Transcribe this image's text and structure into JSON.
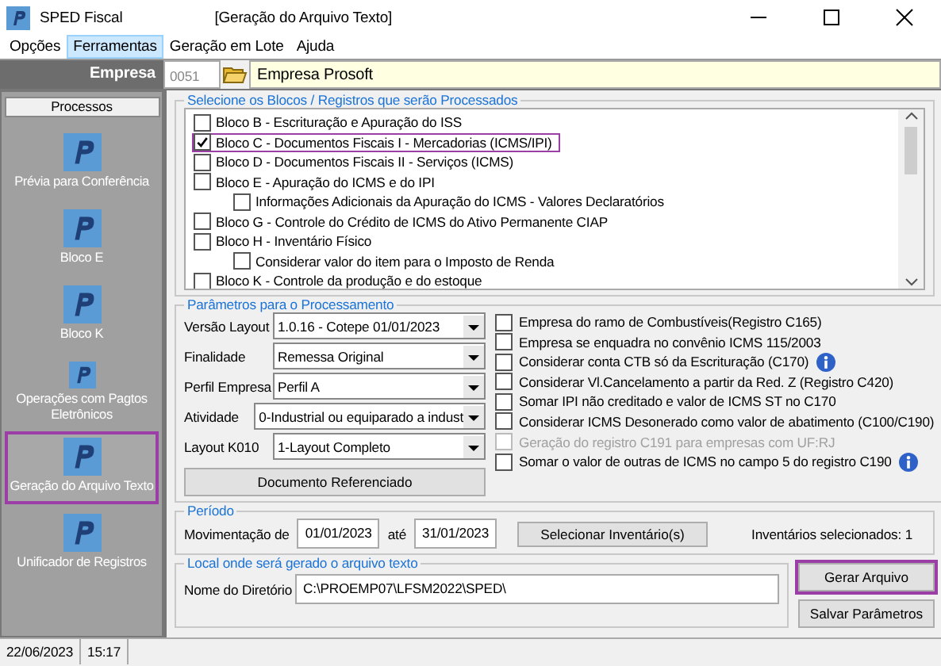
{
  "window": {
    "app_title": "SPED Fiscal",
    "document_title": "[Geração do Arquivo Texto]"
  },
  "menu": [
    {
      "label": "Opções",
      "selected": false
    },
    {
      "label": "Ferramentas",
      "selected": true
    },
    {
      "label": "Geração em Lote",
      "selected": false
    },
    {
      "label": "Ajuda",
      "selected": false
    }
  ],
  "company": {
    "label": "Empresa",
    "code": "0051",
    "name": "Empresa Prosoft"
  },
  "sidebar": {
    "header": "Processos",
    "items": [
      {
        "label": "Prévia para Conferência",
        "selected": false
      },
      {
        "label": "Bloco E",
        "selected": false
      },
      {
        "label": "Bloco K",
        "selected": false
      },
      {
        "label": "Operações com Pagtos Eletrônicos",
        "selected": false
      },
      {
        "label": "Geração do Arquivo Texto",
        "selected": true
      },
      {
        "label": "Unificador de Registros",
        "selected": false
      }
    ]
  },
  "blocks": {
    "title": "Selecione os Blocos / Registros que serão Processados",
    "items": [
      {
        "label": "Bloco B - Escrituração e Apuração do ISS",
        "checked": false,
        "highlighted": false
      },
      {
        "label": "Bloco C - Documentos Fiscais I - Mercadorias (ICMS/IPI)",
        "checked": true,
        "highlighted": true
      },
      {
        "label": "Bloco D - Documentos Fiscais II - Serviços (ICMS)",
        "checked": false,
        "highlighted": false
      },
      {
        "label": "Bloco E - Apuração do ICMS e do IPI",
        "checked": false,
        "highlighted": false,
        "children": [
          {
            "label": "Informações Adicionais da Apuração do ICMS - Valores Declaratórios",
            "checked": false,
            "highlighted": false
          }
        ]
      },
      {
        "label": "Bloco G - Controle do Crédito de ICMS do Ativo Permanente CIAP",
        "checked": false,
        "highlighted": false
      },
      {
        "label": "Bloco H - Inventário Físico",
        "checked": false,
        "highlighted": false,
        "children": [
          {
            "label": "Considerar valor do item para o Imposto de Renda",
            "checked": false,
            "highlighted": false
          }
        ]
      },
      {
        "label": "Bloco K - Controle da produção e do estoque",
        "checked": false,
        "highlighted": false
      }
    ]
  },
  "parameters": {
    "title": "Parâmetros para o Processamento",
    "fields": [
      {
        "label": "Versão Layout",
        "value": "1.0.16 - Cotepe 01/01/2023"
      },
      {
        "label": "Finalidade",
        "value": "Remessa Original"
      },
      {
        "label": "Perfil Empresa",
        "value": "Perfil A"
      },
      {
        "label": "Atividade",
        "value": "0-Industrial ou equiparado a indust"
      },
      {
        "label": "Layout K010",
        "value": "1-Layout Completo"
      }
    ],
    "button": "Documento Referenciado",
    "options": [
      {
        "label": "Empresa do ramo de Combustíveis(Registro C165)",
        "checked": false,
        "disabled": false
      },
      {
        "label": "Empresa se enquadra no convênio ICMS 115/2003",
        "checked": false,
        "disabled": false
      },
      {
        "label": "Considerar conta CTB só da Escrituração (C170)",
        "checked": false,
        "disabled": false,
        "info": true
      },
      {
        "label": "Considerar Vl.Cancelamento a partir da Red. Z (Registro C420)",
        "checked": false,
        "disabled": false
      },
      {
        "label": "Somar IPI não creditado e valor de ICMS ST no C170",
        "checked": false,
        "disabled": false
      },
      {
        "label": "Considerar ICMS Desonerado como valor de abatimento (C100/C190)",
        "checked": false,
        "disabled": false
      },
      {
        "label": "Geração do registro C191 para empresas com UF:RJ",
        "checked": false,
        "disabled": true
      },
      {
        "label": "Somar o valor de outras de ICMS no campo 5 do registro C190",
        "checked": false,
        "disabled": false,
        "info": true
      }
    ]
  },
  "period": {
    "title": "Período",
    "from_label": "Movimentação de",
    "from": "01/01/2023",
    "to_label": "até",
    "to": "31/01/2023",
    "button": "Selecionar Inventário(s)",
    "inventory_label": "Inventários selecionados:",
    "inventory_count": "1"
  },
  "output": {
    "title": "Local onde será gerado o arquivo texto",
    "label": "Nome do Diretório",
    "value": "C:\\PROEMP07\\LFSM2022\\SPED\\"
  },
  "buttons": [
    {
      "label": "Gerar Arquivo",
      "highlighted": true
    },
    {
      "label": "Salvar Parâmetros",
      "highlighted": false
    }
  ],
  "status_bar": {
    "date": "22/06/2023",
    "time": "15:17"
  }
}
